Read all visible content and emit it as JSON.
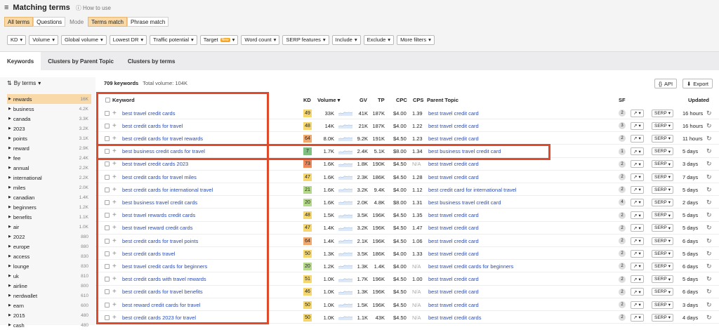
{
  "header": {
    "title": "Matching terms",
    "howto": "How to use"
  },
  "mode": {
    "all_terms": "All terms",
    "questions": "Questions",
    "mode_label": "Mode",
    "terms_match": "Terms match",
    "phrase_match": "Phrase match"
  },
  "filters": [
    "KD",
    "Volume",
    "Global volume",
    "Lowest DR",
    "Traffic potential",
    "Target",
    "Word count",
    "SERP features",
    "Include",
    "Exclude",
    "More filters"
  ],
  "new_badge": "New",
  "tabs": [
    "Keywords",
    "Clusters by Parent Topic",
    "Clusters by terms"
  ],
  "sidebar": {
    "by_terms": "By terms",
    "items": [
      {
        "label": "rewards",
        "count": "16K"
      },
      {
        "label": "business",
        "count": "4.2K"
      },
      {
        "label": "canada",
        "count": "3.3K"
      },
      {
        "label": "2023",
        "count": "3.2K"
      },
      {
        "label": "points",
        "count": "3.1K"
      },
      {
        "label": "reward",
        "count": "2.9K"
      },
      {
        "label": "fee",
        "count": "2.4K"
      },
      {
        "label": "annual",
        "count": "2.2K"
      },
      {
        "label": "international",
        "count": "2.2K"
      },
      {
        "label": "miles",
        "count": "2.0K"
      },
      {
        "label": "canadian",
        "count": "1.4K"
      },
      {
        "label": "beginners",
        "count": "1.2K"
      },
      {
        "label": "benefits",
        "count": "1.1K"
      },
      {
        "label": "air",
        "count": "1.0K"
      },
      {
        "label": "2022",
        "count": "880"
      },
      {
        "label": "europe",
        "count": "880"
      },
      {
        "label": "access",
        "count": "830"
      },
      {
        "label": "lounge",
        "count": "830"
      },
      {
        "label": "uk",
        "count": "810"
      },
      {
        "label": "airline",
        "count": "800"
      },
      {
        "label": "nerdwallet",
        "count": "610"
      },
      {
        "label": "earn",
        "count": "600"
      },
      {
        "label": "2015",
        "count": "480"
      },
      {
        "label": "cash",
        "count": "480"
      }
    ]
  },
  "stats": {
    "keywords": "709 keywords",
    "total": "Total volume: 104K"
  },
  "actions": {
    "api": "API",
    "export": "Export"
  },
  "columns": {
    "keyword": "Keyword",
    "kd": "KD",
    "volume": "Volume",
    "gv": "GV",
    "tp": "TP",
    "cpc": "CPC",
    "cps": "CPS",
    "parent": "Parent Topic",
    "sf": "SF",
    "updated": "Updated"
  },
  "serp_label": "SERP",
  "rows": [
    {
      "kw": "best travel credit cards",
      "kd": "49",
      "kdc": "#f5d76e",
      "vol": "33K",
      "gv": "41K",
      "tp": "187K",
      "cpc": "$4.00",
      "cps": "1.39",
      "pt": "best travel credit card",
      "sf": "2",
      "up": "16 hours"
    },
    {
      "kw": "best credit cards for travel",
      "kd": "48",
      "kdc": "#f5d76e",
      "vol": "14K",
      "gv": "21K",
      "tp": "187K",
      "cpc": "$4.00",
      "cps": "1.22",
      "pt": "best travel credit card",
      "sf": "3",
      "up": "16 hours"
    },
    {
      "kw": "best credit cards for travel rewards",
      "kd": "64",
      "kdc": "#f2a86a",
      "vol": "8.0K",
      "gv": "9.2K",
      "tp": "191K",
      "cpc": "$4.50",
      "cps": "1.23",
      "pt": "best travel credit card",
      "sf": "2",
      "up": "11 hours"
    },
    {
      "kw": "best business credit cards for travel",
      "kd": "7",
      "kdc": "#7fbf7f",
      "vol": "1.7K",
      "gv": "2.4K",
      "tp": "5.1K",
      "cpc": "$8.00",
      "cps": "1.34",
      "pt": "best business travel credit card",
      "sf": "1",
      "up": "5 days"
    },
    {
      "kw": "best travel credit cards 2023",
      "kd": "73",
      "kdc": "#ee8a5a",
      "vol": "1.6K",
      "gv": "1.8K",
      "tp": "190K",
      "cpc": "$4.50",
      "cps": "N/A",
      "pt": "best travel credit card",
      "sf": "2",
      "up": "3 days"
    },
    {
      "kw": "best credit cards for travel miles",
      "kd": "47",
      "kdc": "#f5d76e",
      "vol": "1.6K",
      "gv": "2.3K",
      "tp": "186K",
      "cpc": "$4.50",
      "cps": "1.28",
      "pt": "best travel credit card",
      "sf": "2",
      "up": "7 days"
    },
    {
      "kw": "best credit cards for international travel",
      "kd": "21",
      "kdc": "#b5d98a",
      "vol": "1.6K",
      "gv": "3.2K",
      "tp": "9.4K",
      "cpc": "$4.00",
      "cps": "1.12",
      "pt": "best credit card for international travel",
      "sf": "2",
      "up": "5 days"
    },
    {
      "kw": "best business travel credit cards",
      "kd": "20",
      "kdc": "#b5d98a",
      "vol": "1.6K",
      "gv": "2.0K",
      "tp": "4.8K",
      "cpc": "$8.00",
      "cps": "1.31",
      "pt": "best business travel credit card",
      "sf": "4",
      "up": "2 days"
    },
    {
      "kw": "best travel rewards credit cards",
      "kd": "48",
      "kdc": "#f5d76e",
      "vol": "1.5K",
      "gv": "3.5K",
      "tp": "196K",
      "cpc": "$4.50",
      "cps": "1.35",
      "pt": "best travel credit card",
      "sf": "2",
      "up": "5 days"
    },
    {
      "kw": "best travel reward credit cards",
      "kd": "47",
      "kdc": "#f5d76e",
      "vol": "1.4K",
      "gv": "3.2K",
      "tp": "196K",
      "cpc": "$4.50",
      "cps": "1.47",
      "pt": "best travel credit card",
      "sf": "2",
      "up": "5 days"
    },
    {
      "kw": "best credit cards for travel points",
      "kd": "64",
      "kdc": "#f2a86a",
      "vol": "1.4K",
      "gv": "2.1K",
      "tp": "196K",
      "cpc": "$4.50",
      "cps": "1.06",
      "pt": "best travel credit card",
      "sf": "2",
      "up": "6 days"
    },
    {
      "kw": "best credit cards travel",
      "kd": "50",
      "kdc": "#f5d76e",
      "vol": "1.3K",
      "gv": "3.5K",
      "tp": "186K",
      "cpc": "$4.00",
      "cps": "1.33",
      "pt": "best travel credit card",
      "sf": "2",
      "up": "5 days"
    },
    {
      "kw": "best travel credit cards for beginners",
      "kd": "20",
      "kdc": "#b5d98a",
      "vol": "1.2K",
      "gv": "1.3K",
      "tp": "1.4K",
      "cpc": "$4.00",
      "cps": "N/A",
      "pt": "best travel credit cards for beginners",
      "sf": "2",
      "up": "6 days"
    },
    {
      "kw": "best credit cards with travel rewards",
      "kd": "51",
      "kdc": "#f5d76e",
      "vol": "1.0K",
      "gv": "1.7K",
      "tp": "196K",
      "cpc": "$4.50",
      "cps": "1.00",
      "pt": "best travel credit card",
      "sf": "2",
      "up": "5 days"
    },
    {
      "kw": "best credit cards for travel benefits",
      "kd": "46",
      "kdc": "#f5d76e",
      "vol": "1.0K",
      "gv": "1.3K",
      "tp": "196K",
      "cpc": "$4.50",
      "cps": "N/A",
      "pt": "best travel credit card",
      "sf": "2",
      "up": "6 days"
    },
    {
      "kw": "best reward credit cards for travel",
      "kd": "50",
      "kdc": "#f5d76e",
      "vol": "1.0K",
      "gv": "1.5K",
      "tp": "196K",
      "cpc": "$4.50",
      "cps": "N/A",
      "pt": "best travel credit card",
      "sf": "2",
      "up": "3 days"
    },
    {
      "kw": "best credit cards 2023 for travel",
      "kd": "50",
      "kdc": "#f5d76e",
      "vol": "1.0K",
      "gv": "1.1K",
      "tp": "43K",
      "cpc": "$4.50",
      "cps": "N/A",
      "pt": "best travel credit cards",
      "sf": "2",
      "up": "4 days"
    }
  ]
}
